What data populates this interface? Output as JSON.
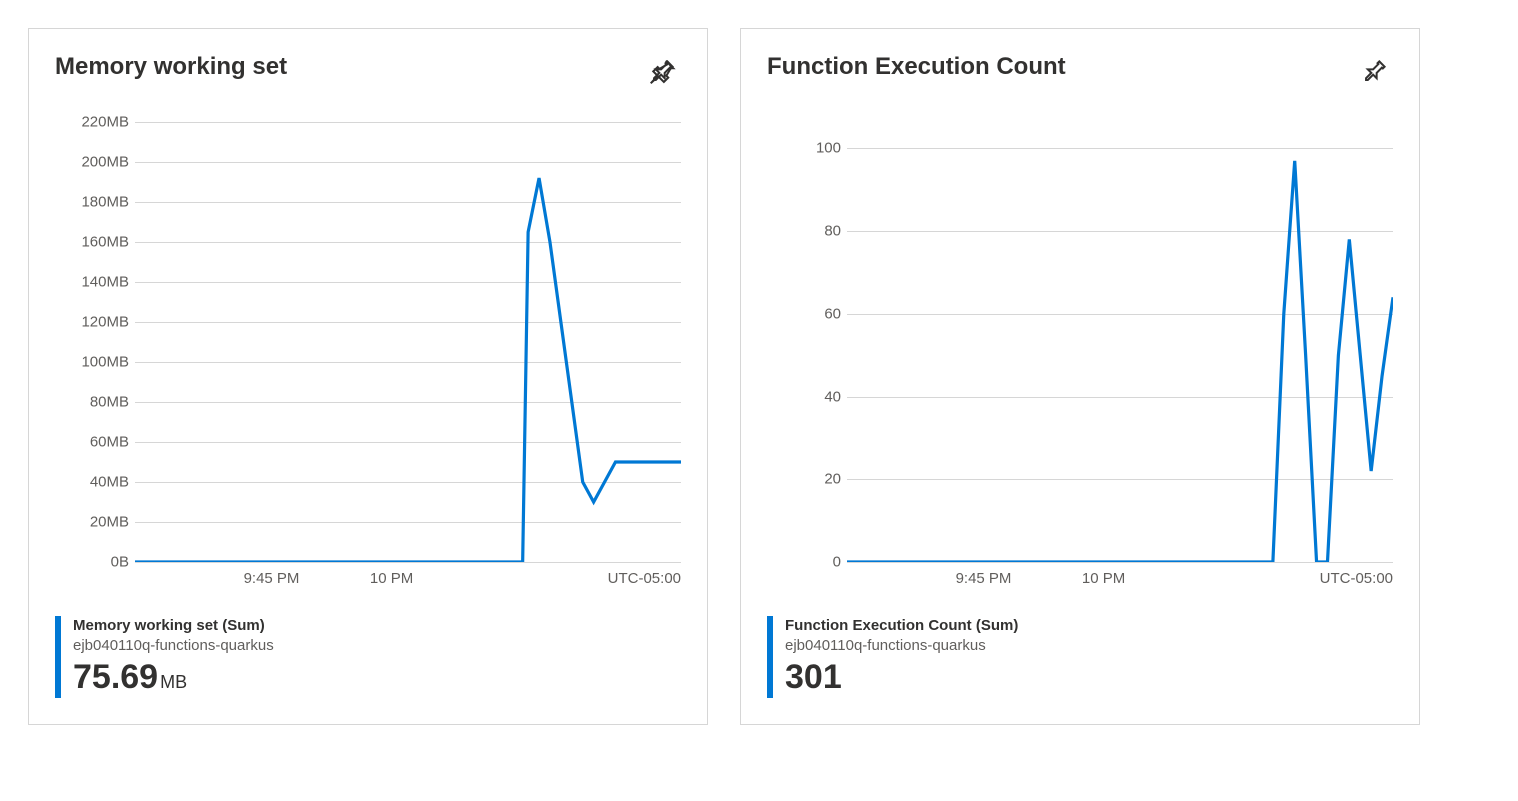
{
  "cards": [
    {
      "title": "Memory working set",
      "legend_metric": "Memory working set (Sum)",
      "legend_resource": "ejb040110q-functions-quarkus",
      "legend_value": "75.69",
      "legend_unit": "MB",
      "y_ticks": [
        "220MB",
        "200MB",
        "180MB",
        "160MB",
        "140MB",
        "120MB",
        "100MB",
        "80MB",
        "60MB",
        "40MB",
        "20MB",
        "0B"
      ],
      "x_ticks": [
        {
          "label": "9:45 PM",
          "pos": 25
        },
        {
          "label": "10 PM",
          "pos": 47
        }
      ],
      "tz": "UTC-05:00"
    },
    {
      "title": "Function Execution Count",
      "legend_metric": "Function Execution Count (Sum)",
      "legend_resource": "ejb040110q-functions-quarkus",
      "legend_value": "301",
      "legend_unit": "",
      "y_ticks": [
        "100",
        "80",
        "60",
        "40",
        "20",
        "0"
      ],
      "x_ticks": [
        {
          "label": "9:45 PM",
          "pos": 25
        },
        {
          "label": "10 PM",
          "pos": 47
        }
      ],
      "tz": "UTC-05:00"
    }
  ],
  "chart_data": [
    {
      "type": "line",
      "title": "Memory working set",
      "xlabel": "",
      "ylabel": "",
      "ylim": [
        0,
        220
      ],
      "y_unit": "MB",
      "x_ticks": [
        "9:45 PM",
        "10 PM"
      ],
      "tz": "UTC-05:00",
      "series": [
        {
          "name": "Memory working set (Sum)",
          "resource": "ejb040110q-functions-quarkus",
          "summary_value": 75.69,
          "summary_unit": "MB",
          "x": [
            0,
            5,
            10,
            15,
            20,
            25,
            30,
            35,
            40,
            45,
            50,
            55,
            60,
            65,
            70,
            71,
            72,
            74,
            76,
            78,
            80,
            82,
            84,
            86,
            88,
            90,
            92,
            94,
            96,
            98,
            100
          ],
          "values": [
            0,
            0,
            0,
            0,
            0,
            0,
            0,
            0,
            0,
            0,
            0,
            0,
            0,
            0,
            0,
            0,
            165,
            192,
            160,
            120,
            80,
            40,
            30,
            40,
            50,
            50,
            50,
            50,
            50,
            50,
            50
          ]
        }
      ]
    },
    {
      "type": "line",
      "title": "Function Execution Count",
      "xlabel": "",
      "ylabel": "",
      "ylim": [
        0,
        100
      ],
      "x_ticks": [
        "9:45 PM",
        "10 PM"
      ],
      "tz": "UTC-05:00",
      "series": [
        {
          "name": "Function Execution Count (Sum)",
          "resource": "ejb040110q-functions-quarkus",
          "summary_value": 301,
          "x": [
            0,
            10,
            20,
            30,
            40,
            50,
            60,
            70,
            75,
            78,
            80,
            82,
            84,
            86,
            88,
            90,
            92,
            94,
            96,
            98,
            100
          ],
          "values": [
            0,
            0,
            0,
            0,
            0,
            0,
            0,
            0,
            0,
            0,
            60,
            97,
            50,
            0,
            0,
            50,
            78,
            50,
            22,
            45,
            64
          ]
        }
      ]
    }
  ]
}
